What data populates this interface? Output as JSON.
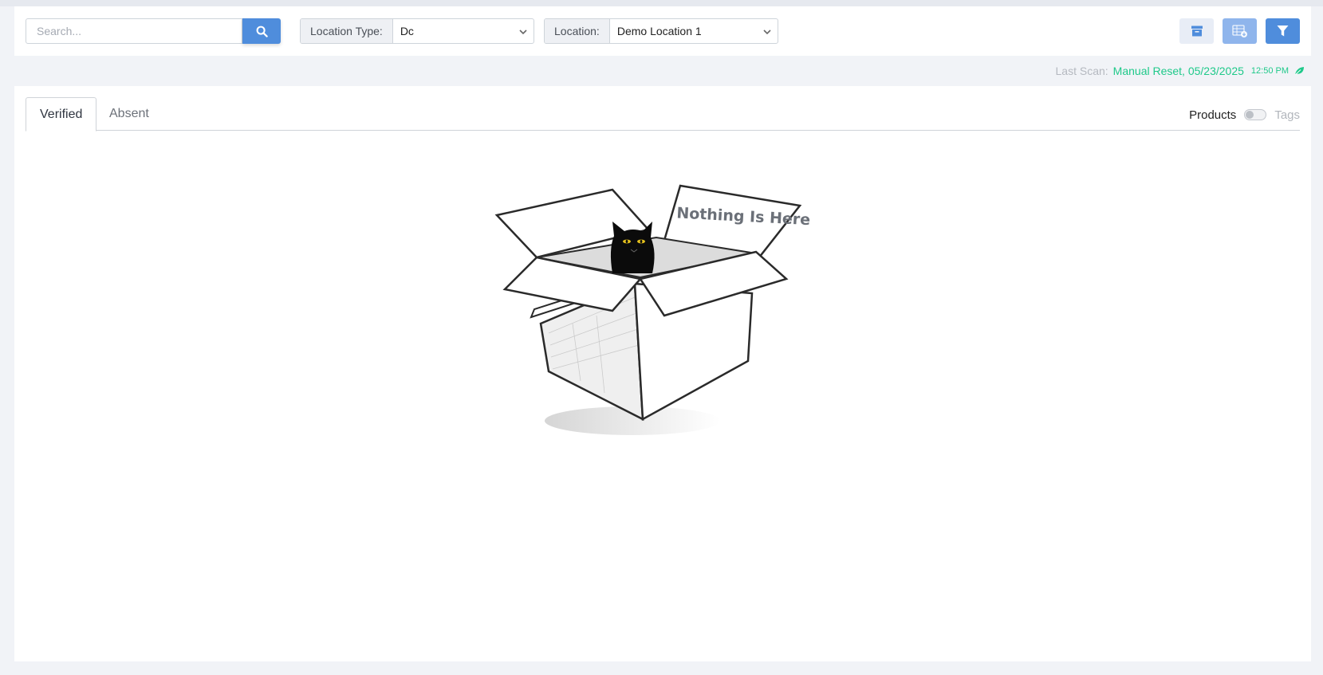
{
  "search": {
    "placeholder": "Search..."
  },
  "filters": {
    "location_type": {
      "label": "Location Type:",
      "value": "Dc"
    },
    "location": {
      "label": "Location:",
      "value": "Demo Location 1"
    }
  },
  "toolbar_icons": [
    "archive-icon",
    "export-excel-icon",
    "filter-icon"
  ],
  "last_scan": {
    "label": "Last Scan:",
    "value": "Manual Reset, 05/23/2025",
    "time": "12:50 PM",
    "icon": "leaf-icon"
  },
  "tabs": [
    {
      "label": "Verified",
      "active": true
    },
    {
      "label": "Absent",
      "active": false
    }
  ],
  "view_toggle": {
    "left_label": "Products",
    "right_label": "Tags",
    "enabled": false
  },
  "empty_state": {
    "text": "Nothing Is Here"
  },
  "colors": {
    "primary": "#4f8ddc",
    "accent_green": "#1fc98a",
    "light_btn": "#e8edf6"
  }
}
